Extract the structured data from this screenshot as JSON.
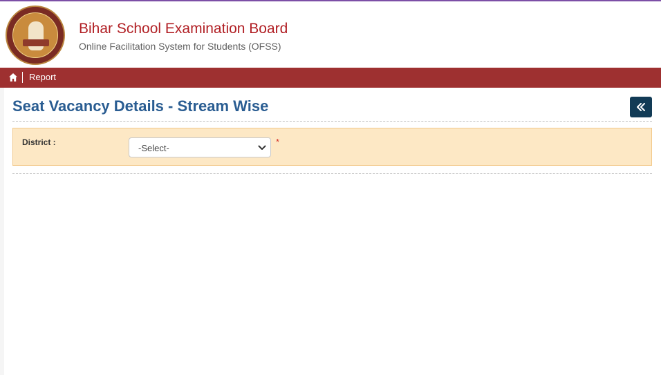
{
  "header": {
    "title": "Bihar School Examination Board",
    "subtitle": "Online Facilitation System for Students (OFSS)",
    "logo_icon": "board-seal-logo"
  },
  "nav": {
    "home_icon": "home-icon",
    "report_label": "Report"
  },
  "main": {
    "page_title": "Seat Vacancy Details - Stream Wise",
    "back_icon": "double-chevron-left-icon",
    "form": {
      "district_label": "District :",
      "district_selected": "-Select-",
      "required_mark": "*"
    }
  },
  "colors": {
    "nav_bg": "#9e3030",
    "title_red": "#b11f24",
    "heading_blue": "#2a5d92",
    "panel_bg": "#fde8c5",
    "button_dark": "#123b56",
    "top_line": "#7c4fa6"
  }
}
